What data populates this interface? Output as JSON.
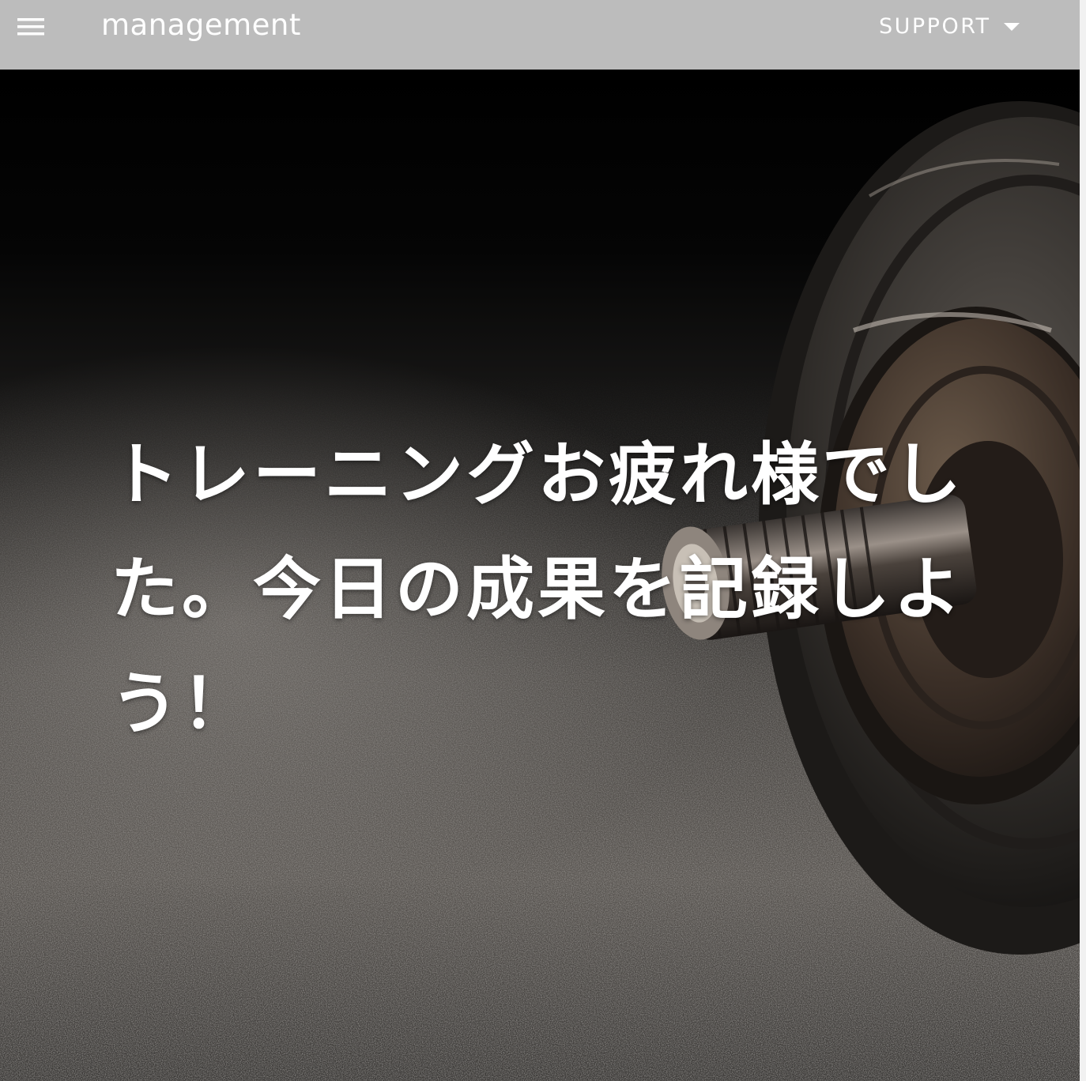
{
  "navbar": {
    "menu_icon": "hamburger-menu-icon",
    "brand": "management",
    "support_label": "SUPPORT",
    "support_icon": "caret-down-icon",
    "background_color": "#bcbcbc",
    "text_color": "#ffffff"
  },
  "hero": {
    "heading": "トレーニングお疲れ様でした。今日の成果を記録しよう！",
    "image": "dumbbell-plate-photo"
  }
}
